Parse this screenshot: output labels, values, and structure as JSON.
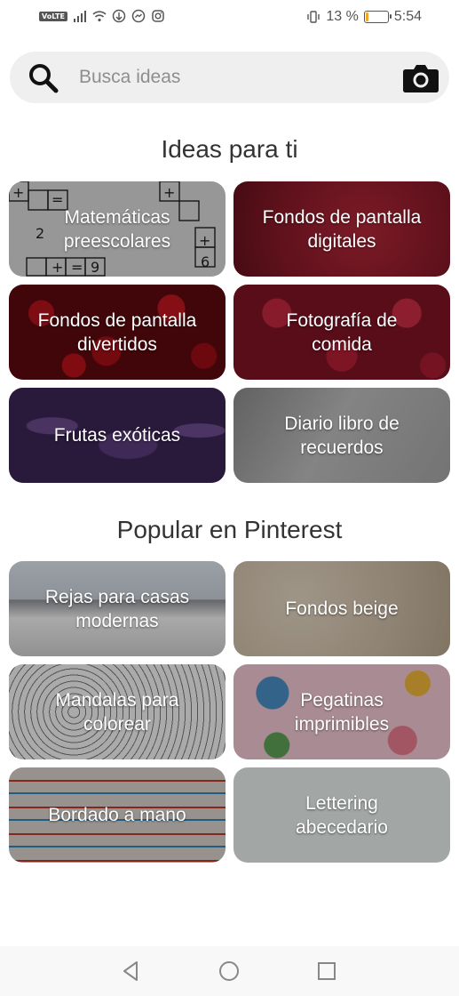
{
  "status_bar": {
    "volte": "VoLTE",
    "battery_text": "13 %",
    "battery_level": 0.13,
    "time": "5:54"
  },
  "search": {
    "placeholder": "Busca ideas"
  },
  "sections": [
    {
      "title": "Ideas para ti",
      "tiles": [
        {
          "label": "Matemáticas\npreescolares"
        },
        {
          "label": "Fondos de pantalla\ndigitales"
        },
        {
          "label": "Fondos de pantalla\ndivertidos"
        },
        {
          "label": "Fotografía de\ncomida"
        },
        {
          "label": "Frutas exóticas"
        },
        {
          "label": "Diario libro de\nrecuerdos"
        }
      ]
    },
    {
      "title": "Popular en Pinterest",
      "tiles": [
        {
          "label": "Rejas para casas\nmodernas"
        },
        {
          "label": "Fondos beige"
        },
        {
          "label": "Mandalas para\ncolorear"
        },
        {
          "label": "Pegatinas\nimprimibles"
        },
        {
          "label": "Bordado a mano"
        },
        {
          "label": "Lettering\nabecedario"
        }
      ]
    }
  ],
  "colors": {
    "battery_fill": "#f5a623",
    "search_bg": "#efefef"
  }
}
